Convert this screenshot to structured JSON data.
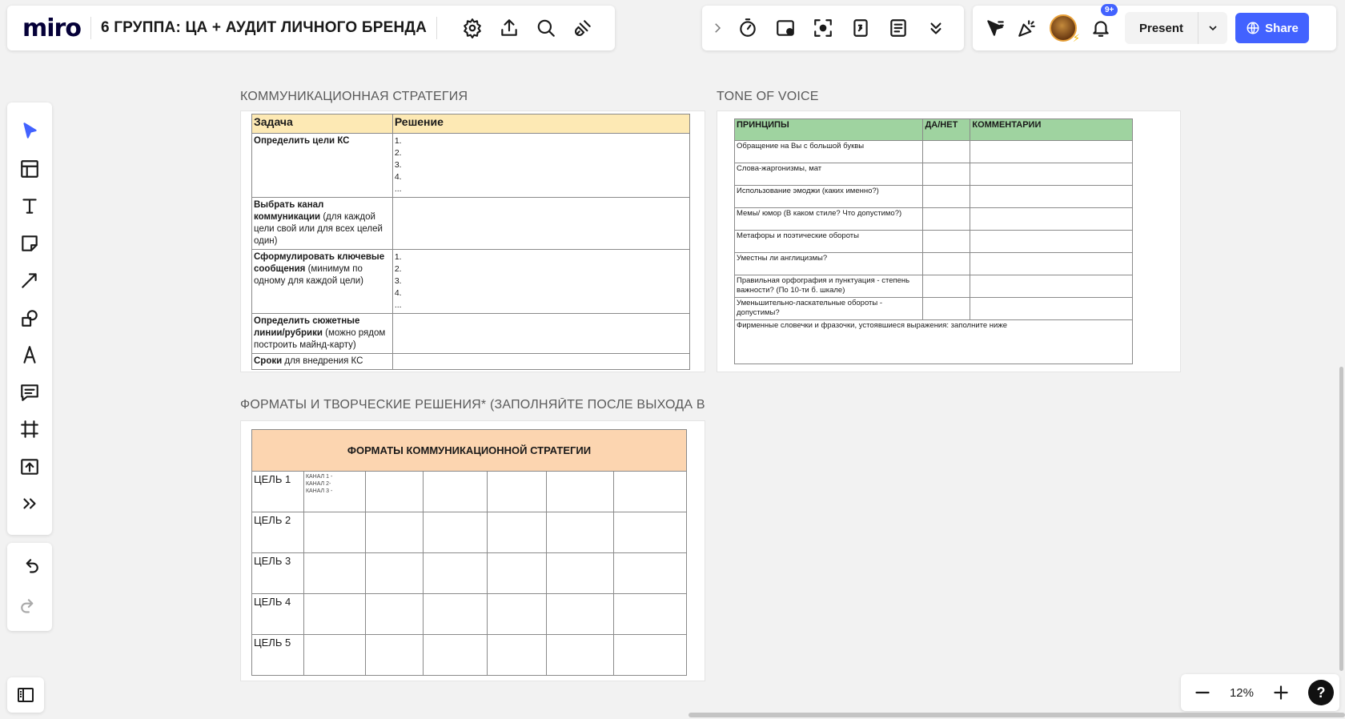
{
  "topbar": {
    "logo": "miro",
    "board_title": "6 ГРУППА: ЦА + АУДИТ ЛИЧНОГО БРЕНДА"
  },
  "right": {
    "notifications_badge": "9+",
    "present_label": "Present",
    "share_label": "Share"
  },
  "zoom": {
    "level": "12%",
    "help": "?"
  },
  "frames": {
    "ks": {
      "title": "КОММУНИКАЦИОННАЯ СТРАТЕГИЯ",
      "headers": [
        "Задача",
        "Решение"
      ],
      "rows": [
        {
          "bold": "Определить цели КС",
          "rest": "",
          "sol": [
            "1.",
            "2.",
            "3.",
            "4.",
            "..."
          ]
        },
        {
          "bold": "Выбрать канал коммуникации",
          "rest": " (для каждой цели свой или для всех целей один)",
          "sol": []
        },
        {
          "bold": "Сформулировать ключевые сообщения",
          "rest": " (минимум по одному для каждой цели)",
          "sol": [
            "1.",
            "2.",
            "3.",
            "4.",
            "..."
          ]
        },
        {
          "bold": "Определить сюжетные линии/рубрики",
          "rest": " (можно рядом построить майнд-карту)",
          "sol": []
        },
        {
          "bold": "Сроки",
          "rest": " для внедрения КС",
          "sol": []
        }
      ]
    },
    "tov": {
      "title": "TONE OF VOICE",
      "headers": [
        "ПРИНЦИПЫ",
        "ДА/НЕТ",
        "КОММЕНТАРИИ"
      ],
      "rows": [
        "Обращение на Вы с большой буквы",
        "Слова-жаргонизмы, мат",
        "Использование эмоджи (каких именно?)",
        "Мемы/ юмор (В каком стиле? Что допустимо?)",
        "Метафоры и поэтические обороты",
        "Уместны ли англицизмы?",
        "Правильная орфография и пунктуация - степень важности? (По 10-ти б. шкале)",
        "Уменьшительно-ласкательные обороты - допустимы?"
      ],
      "footer": "Фирменные словечки и фразочки, устоявшиеся выражения: заполните ниже"
    },
    "fmt": {
      "title": "ФОРМАТЫ И ТВОРЧЕСКИЕ РЕШЕНИЯ* (ЗАПОЛНЯЙТЕ ПОСЛЕ ВЫХОДА В...",
      "header": "ФОРМАТЫ КОММУНИКАЦИОННОЙ СТРАТЕГИИ",
      "goals": [
        "ЦЕЛЬ 1",
        "ЦЕЛЬ 2",
        "ЦЕЛЬ 3",
        "ЦЕЛЬ 4",
        "ЦЕЛЬ 5"
      ],
      "channels": [
        "КАНАЛ 1 -",
        "КАНАЛ 2-",
        "КАНАЛ 3 -"
      ]
    }
  }
}
